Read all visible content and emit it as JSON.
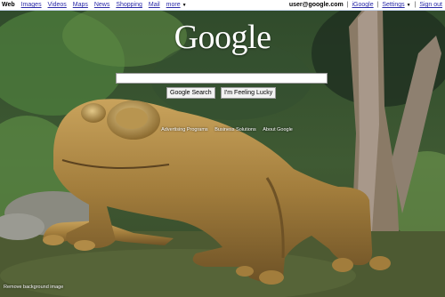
{
  "topbar": {
    "left": [
      {
        "label": "Web",
        "active": true
      },
      {
        "label": "Images"
      },
      {
        "label": "Videos"
      },
      {
        "label": "Maps"
      },
      {
        "label": "News"
      },
      {
        "label": "Shopping"
      },
      {
        "label": "Mail"
      },
      {
        "label": "more"
      }
    ],
    "more_arrow": "▼",
    "user_email": "user@google.com",
    "right": [
      {
        "label": "iGoogle"
      },
      {
        "label": "Settings"
      },
      {
        "label": "Sign out"
      }
    ],
    "settings_arrow": "▼"
  },
  "logo_text": "Google",
  "search": {
    "value": "",
    "buttons": [
      "Google Search",
      "I'm Feeling Lucky"
    ]
  },
  "footer_links": [
    "Advertising Programs",
    "Business Solutions",
    "About Google"
  ],
  "remove_background": "Remove background image",
  "colors": {
    "link": "#2a2aa8",
    "frog": "#9b7a3a",
    "forest_dark": "#263b1f"
  }
}
